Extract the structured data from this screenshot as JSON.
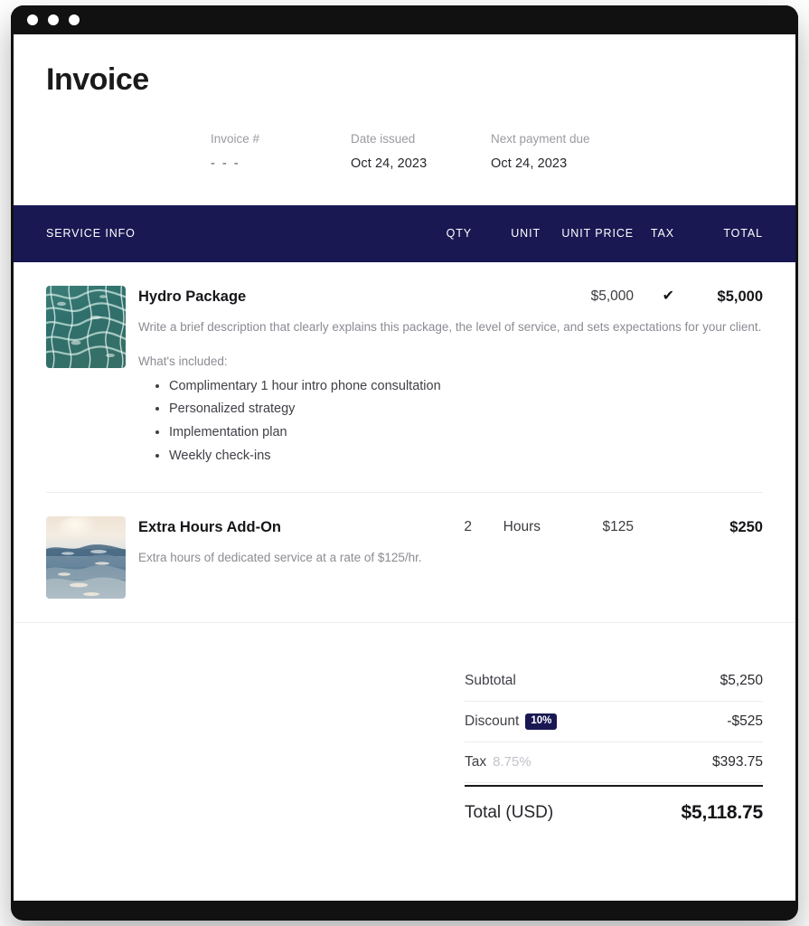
{
  "window": {
    "traffic_lights": [
      "close",
      "minimize",
      "maximize"
    ]
  },
  "header": {
    "title": "Invoice",
    "meta": [
      {
        "label": "Invoice #",
        "value": "- - -"
      },
      {
        "label": "Date issued",
        "value": "Oct 24, 2023"
      },
      {
        "label": "Next payment due",
        "value": "Oct 24, 2023"
      }
    ]
  },
  "table": {
    "columns": {
      "service": "SERVICE INFO",
      "qty": "QTY",
      "unit": "UNIT",
      "unit_price": "UNIT PRICE",
      "tax": "TAX",
      "total": "TOTAL"
    },
    "rows": [
      {
        "name": "Hydro Package",
        "thumbnail": "pool-water-thumbnail",
        "description": "Write a brief description that clearly explains this package, the level of service, and sets expectations for your client.",
        "included_label": "What's included:",
        "included": [
          "Complimentary 1 hour intro phone consultation",
          "Personalized strategy",
          "Implementation plan",
          "Weekly check-ins"
        ],
        "qty": "",
        "unit": "",
        "unit_price": "$5,000",
        "tax": "✔",
        "total": "$5,000"
      },
      {
        "name": "Extra Hours Add-On",
        "thumbnail": "ocean-sunset-thumbnail",
        "description": "Extra hours of dedicated service at a rate of $125/hr.",
        "included_label": "",
        "included": [],
        "qty": "2",
        "unit": "Hours",
        "unit_price": "$125",
        "tax": "",
        "total": "$250"
      }
    ]
  },
  "totals": {
    "subtotal": {
      "label": "Subtotal",
      "amount": "$5,250"
    },
    "discount": {
      "label": "Discount",
      "badge": "10%",
      "amount": "-$525"
    },
    "tax": {
      "label": "Tax",
      "rate": "8.75%",
      "amount": "$393.75"
    },
    "grand": {
      "label": "Total (USD)",
      "amount": "$5,118.75"
    }
  },
  "colors": {
    "navy": "#191853",
    "ink": "#16161a",
    "muted": "#8b8b93",
    "divider": "#ededf1"
  }
}
